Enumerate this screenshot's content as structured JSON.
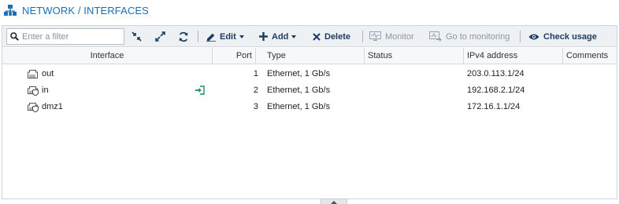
{
  "header": {
    "title": "NETWORK / INTERFACES",
    "icon": "network-icon",
    "accent": "#1a6fb3"
  },
  "toolbar": {
    "search_placeholder": "Enter a filter",
    "search_value": "",
    "collapse_icon": "collapse-arrows-icon",
    "expand_icon": "expand-arrows-icon",
    "refresh_icon": "refresh-icon",
    "edit_label": "Edit",
    "add_label": "Add",
    "delete_label": "Delete",
    "monitor_label": "Monitor",
    "goto_monitoring_label": "Go to monitoring",
    "check_usage_label": "Check usage"
  },
  "table": {
    "columns": [
      "Interface",
      "Port",
      "Type",
      "Status",
      "IPv4 address",
      "Comments"
    ],
    "rows": [
      {
        "interface": "out",
        "port": "1",
        "type": "Ethernet, 1 Gb/s",
        "status": "",
        "ipv4": "203.0.113.1/24",
        "comments": "",
        "icon": "ethernet-port-icon",
        "badge": ""
      },
      {
        "interface": "in",
        "port": "2",
        "type": "Ethernet, 1 Gb/s",
        "status": "",
        "ipv4": "192.168.2.1/24",
        "comments": "",
        "icon": "protected-port-icon",
        "badge": "sign-in-icon"
      },
      {
        "interface": "dmz1",
        "port": "3",
        "type": "Ethernet, 1 Gb/s",
        "status": "",
        "ipv4": "172.16.1.1/24",
        "comments": "",
        "icon": "protected-port-icon",
        "badge": ""
      }
    ]
  }
}
